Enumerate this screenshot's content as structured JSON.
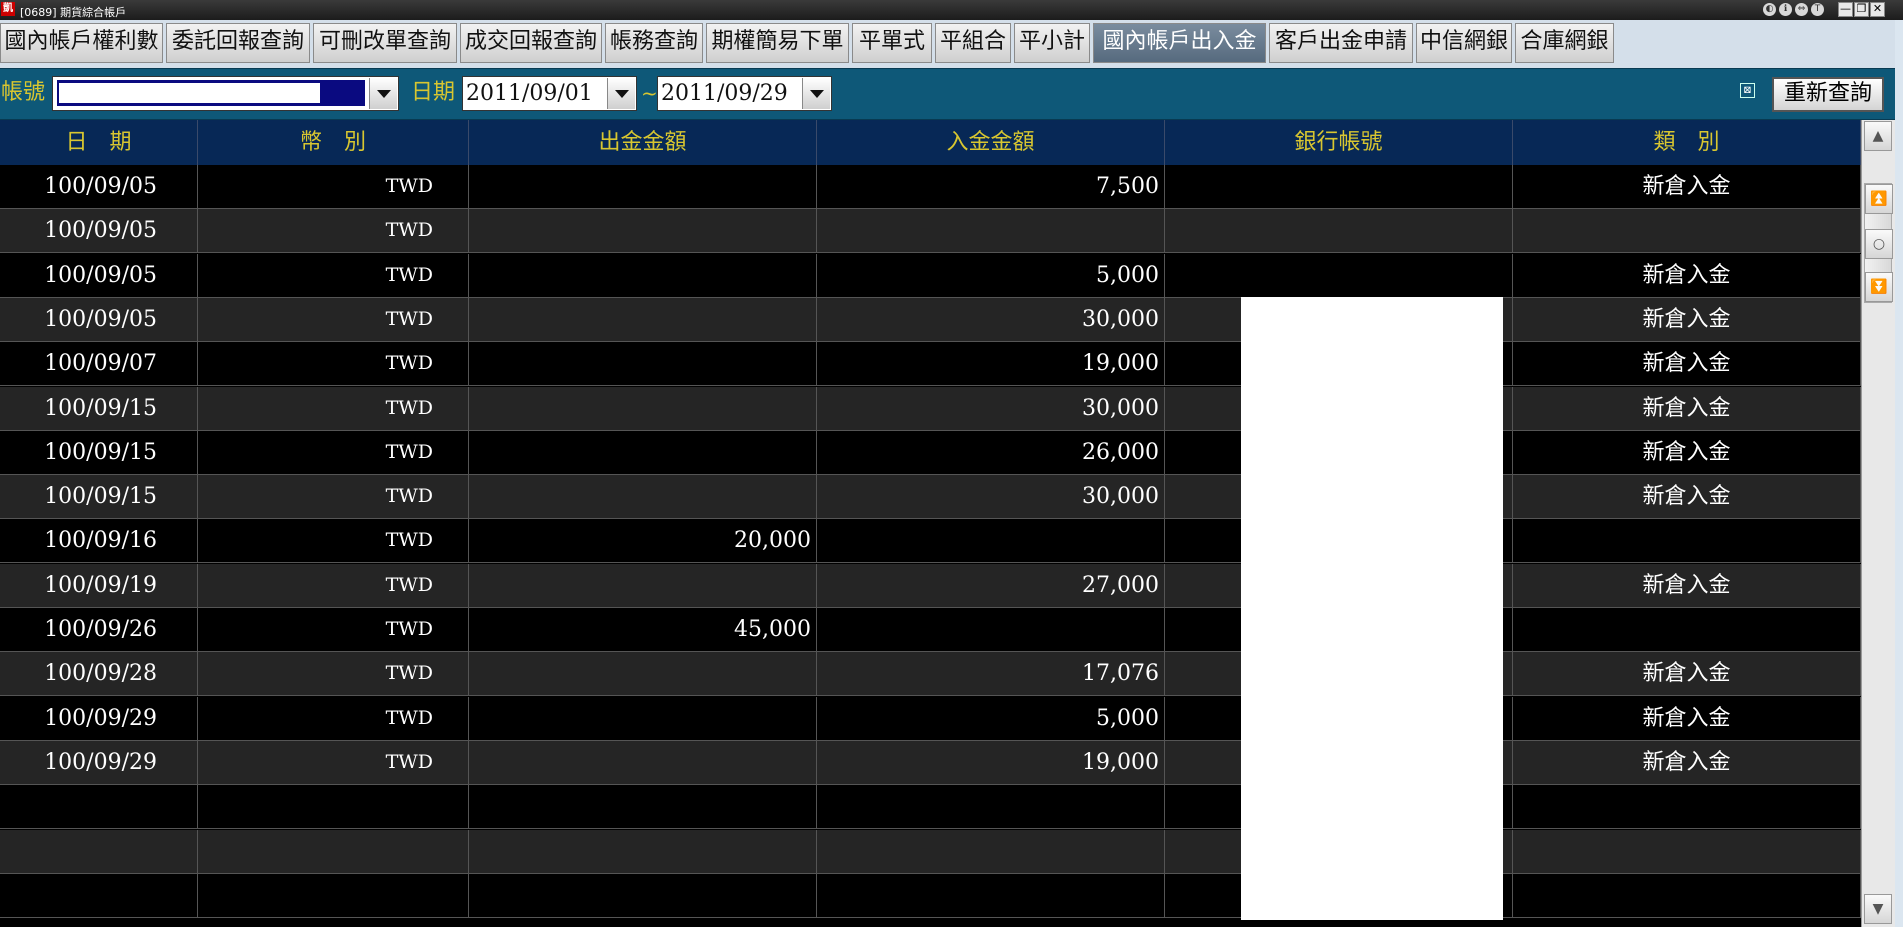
{
  "window": {
    "icon_text": "凱",
    "title": "[0689] 期貨綜合帳戶",
    "title_buttons": [
      "◐",
      "ℹ",
      "⇔",
      "T"
    ],
    "minimize": "—",
    "restore": "❐",
    "close": "✕"
  },
  "tabs": [
    {
      "label": "國內帳戶權利數"
    },
    {
      "label": "委託回報查詢"
    },
    {
      "label": "可刪改單查詢"
    },
    {
      "label": "成交回報查詢"
    },
    {
      "label": "帳務查詢"
    },
    {
      "label": "期權簡易下單"
    },
    {
      "label": "平單式"
    },
    {
      "label": "平組合"
    },
    {
      "label": "平小計"
    },
    {
      "label": "國內帳戶出入金"
    },
    {
      "label": "客戶出金申請"
    },
    {
      "label": "中信網銀"
    },
    {
      "label": "合庫網銀"
    }
  ],
  "active_tab": "國內帳戶出入金",
  "filter": {
    "account_label": "帳號",
    "account_value": "",
    "date_label": "日期",
    "date_from": "2011/09/01",
    "separator": "~",
    "date_to": "2011/09/29",
    "requery_label": "重新查詢"
  },
  "table": {
    "columns": [
      "日　期",
      "幣　別",
      "出金金額",
      "入金金額",
      "銀行帳號",
      "類　別"
    ],
    "rows": [
      {
        "date": "100/09/05",
        "currency": "TWD",
        "withdraw": "",
        "deposit": "7,500",
        "bank": "",
        "type": "新倉入金"
      },
      {
        "date": "100/09/05",
        "currency": "TWD",
        "withdraw": "",
        "deposit": "",
        "bank": "",
        "type": ""
      },
      {
        "date": "100/09/05",
        "currency": "TWD",
        "withdraw": "",
        "deposit": "5,000",
        "bank": "",
        "type": "新倉入金"
      },
      {
        "date": "100/09/05",
        "currency": "TWD",
        "withdraw": "",
        "deposit": "30,000",
        "bank": "",
        "type": "新倉入金"
      },
      {
        "date": "100/09/07",
        "currency": "TWD",
        "withdraw": "",
        "deposit": "19,000",
        "bank": "",
        "type": "新倉入金"
      },
      {
        "date": "100/09/15",
        "currency": "TWD",
        "withdraw": "",
        "deposit": "30,000",
        "bank": "",
        "type": "新倉入金"
      },
      {
        "date": "100/09/15",
        "currency": "TWD",
        "withdraw": "",
        "deposit": "26,000",
        "bank": "",
        "type": "新倉入金"
      },
      {
        "date": "100/09/15",
        "currency": "TWD",
        "withdraw": "",
        "deposit": "30,000",
        "bank": "",
        "type": "新倉入金"
      },
      {
        "date": "100/09/16",
        "currency": "TWD",
        "withdraw": "20,000",
        "deposit": "",
        "bank": "",
        "type": ""
      },
      {
        "date": "100/09/19",
        "currency": "TWD",
        "withdraw": "",
        "deposit": "27,000",
        "bank": "",
        "type": "新倉入金"
      },
      {
        "date": "100/09/26",
        "currency": "TWD",
        "withdraw": "45,000",
        "deposit": "",
        "bank": "",
        "type": ""
      },
      {
        "date": "100/09/28",
        "currency": "TWD",
        "withdraw": "",
        "deposit": "17,076",
        "bank": "",
        "type": "新倉入金"
      },
      {
        "date": "100/09/29",
        "currency": "TWD",
        "withdraw": "",
        "deposit": "5,000",
        "bank": "",
        "type": "新倉入金"
      },
      {
        "date": "100/09/29",
        "currency": "TWD",
        "withdraw": "",
        "deposit": "19,000",
        "bank": "",
        "type": "新倉入金"
      },
      {
        "date": "",
        "currency": "",
        "withdraw": "",
        "deposit": "",
        "bank": "",
        "type": ""
      },
      {
        "date": "",
        "currency": "",
        "withdraw": "",
        "deposit": "",
        "bank": "",
        "type": ""
      },
      {
        "date": "",
        "currency": "",
        "withdraw": "",
        "deposit": "",
        "bank": "",
        "type": ""
      }
    ]
  },
  "colors": {
    "header_bg": "#072856",
    "header_text": "#d8c630",
    "filter_bg": "#0e5878",
    "row_odd": "#000000",
    "row_even": "#252525"
  },
  "icons": {
    "scroll_up": "triangle-up",
    "scroll_top": "double-up",
    "scroll_mid": "circle",
    "scroll_bottom": "double-down",
    "scroll_down": "triangle-down",
    "settings_small": "small-square-icon"
  }
}
